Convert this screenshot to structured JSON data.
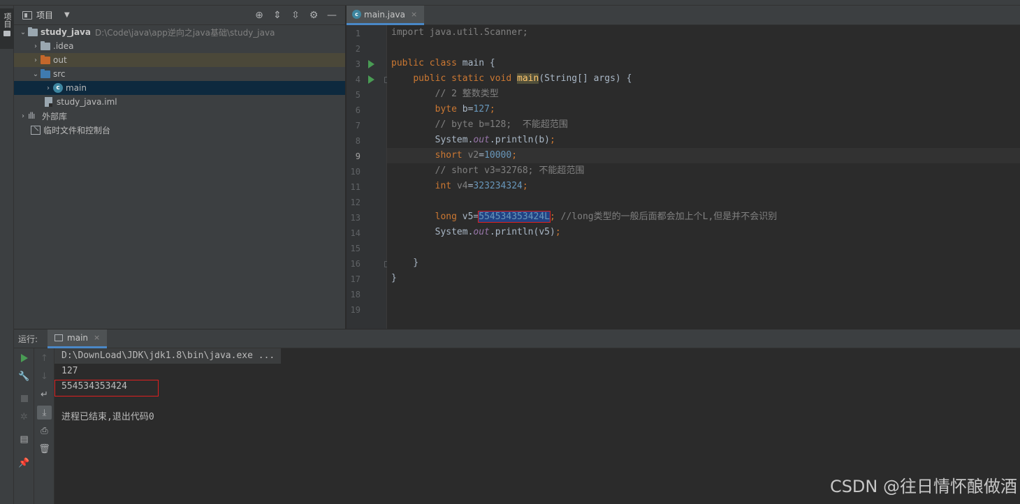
{
  "stripe": {
    "project_label": "项目"
  },
  "project_panel": {
    "title": "项目",
    "tree": [
      {
        "label": "study_java",
        "path": "D:\\Code\\java\\app逆向之java基础\\study_java"
      },
      {
        "label": ".idea"
      },
      {
        "label": "out"
      },
      {
        "label": "src"
      },
      {
        "label": "main"
      },
      {
        "label": "study_java.iml"
      },
      {
        "label": "外部库"
      },
      {
        "label": "临时文件和控制台"
      }
    ]
  },
  "editor": {
    "tab": {
      "label": "main.java",
      "close": "×"
    },
    "line_numbers": [
      "1",
      "2",
      "3",
      "4",
      "5",
      "6",
      "7",
      "8",
      "9",
      "10",
      "11",
      "12",
      "13",
      "14",
      "15",
      "16",
      "17",
      "18",
      "19"
    ],
    "current_line": 9
  },
  "run_panel": {
    "label": "运行:",
    "tab": "main",
    "console": {
      "command": "D:\\DownLoad\\JDK\\jdk1.8\\bin\\java.exe ...",
      "output": [
        "127",
        "554534353424"
      ],
      "exit": "进程已结束,退出代码0"
    }
  },
  "watermark": "CSDN @往日情怀酿做酒",
  "colors": {
    "keyword": "#cc7832",
    "comment": "#808080",
    "number": "#6897bb",
    "static_field": "#9876aa",
    "method": "#ffc66d",
    "run_green": "#499c54",
    "annotation_red": "#e02020"
  }
}
